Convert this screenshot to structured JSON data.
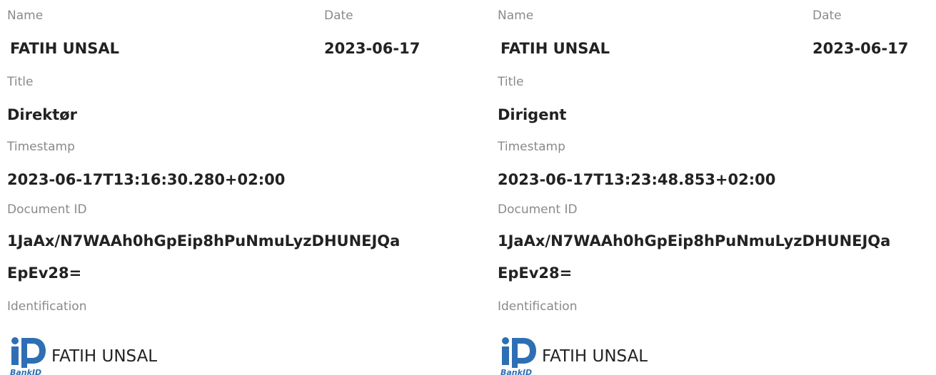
{
  "signatures": [
    {
      "name_label": "Name",
      "date_label": "Date",
      "name": "FATIH UNSAL",
      "date": "2023-06-17",
      "title_label": "Title",
      "title": "Direktør",
      "timestamp_label": "Timestamp",
      "timestamp": "2023-06-17T13:16:30.280+02:00",
      "document_id_label": "Document ID",
      "document_id_line1": "1JaAx/N7WAAh0hGpEip8hPuNmuLyzDHUNEJQa",
      "document_id_line2": "EpEv28=",
      "identification_label": "Identification",
      "identification_icon": "bankid-logo-icon",
      "identification_logo_text": "BankID",
      "identification_name": "FATIH UNSAL"
    },
    {
      "name_label": "Name",
      "date_label": "Date",
      "name": "FATIH UNSAL",
      "date": "2023-06-17",
      "title_label": "Title",
      "title": "Dirigent",
      "timestamp_label": "Timestamp",
      "timestamp": "2023-06-17T13:23:48.853+02:00",
      "document_id_label": "Document ID",
      "document_id_line1": "1JaAx/N7WAAh0hGpEip8hPuNmuLyzDHUNEJQa",
      "document_id_line2": "EpEv28=",
      "identification_label": "Identification",
      "identification_icon": "bankid-logo-icon",
      "identification_logo_text": "BankID",
      "identification_name": "FATIH UNSAL"
    }
  ],
  "colors": {
    "label": "#8a8a8a",
    "value": "#222222",
    "bankid_blue": "#2e6fb4"
  }
}
